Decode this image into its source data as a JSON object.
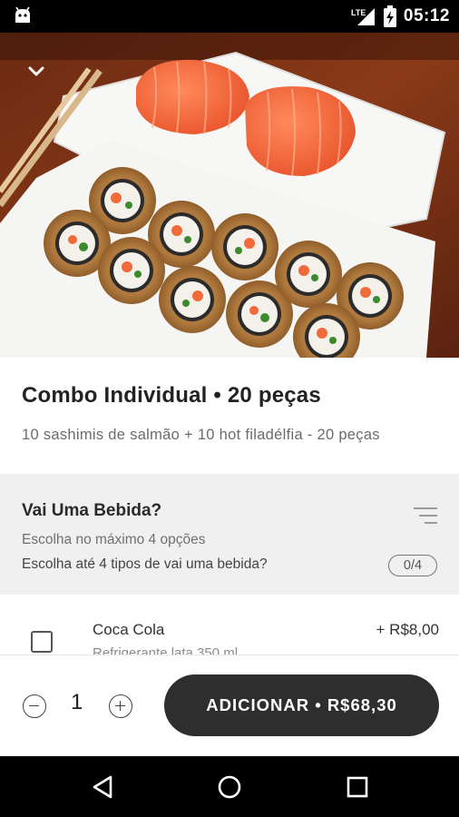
{
  "status_bar": {
    "time": "05:12",
    "network": "LTE",
    "icons": [
      "android-icon",
      "lte-signal-icon",
      "battery-charging-icon"
    ]
  },
  "header": {
    "collapse_icon": "chevron-down-icon",
    "image": "sushi-combo-photo"
  },
  "product": {
    "title": "Combo Individual • 20 peças",
    "description": "10 sashimis de salmão + 10 hot filadélfia - 20 peças"
  },
  "option_group": {
    "title": "Vai Uma Bebida?",
    "max_text": "Escolha no máximo 4 opções",
    "choose_text": "Escolha até 4 tipos de vai uma bebida?",
    "count": "0/4",
    "icon": "filter-lines-icon"
  },
  "options": [
    {
      "name": "Coca Cola",
      "price": "+ R$8,00",
      "detail": "Refrigerante lata 350 ml",
      "checked": false
    }
  ],
  "footer": {
    "quantity": "1",
    "add_label": "ADICIONAR • R$68,30"
  },
  "nav_bar": {
    "icons": [
      "back-triangle-icon",
      "home-circle-icon",
      "recents-square-icon"
    ]
  },
  "colors": {
    "button": "#2e2e2e",
    "group_background": "#f0f0f0",
    "system_bars": "#000000"
  }
}
